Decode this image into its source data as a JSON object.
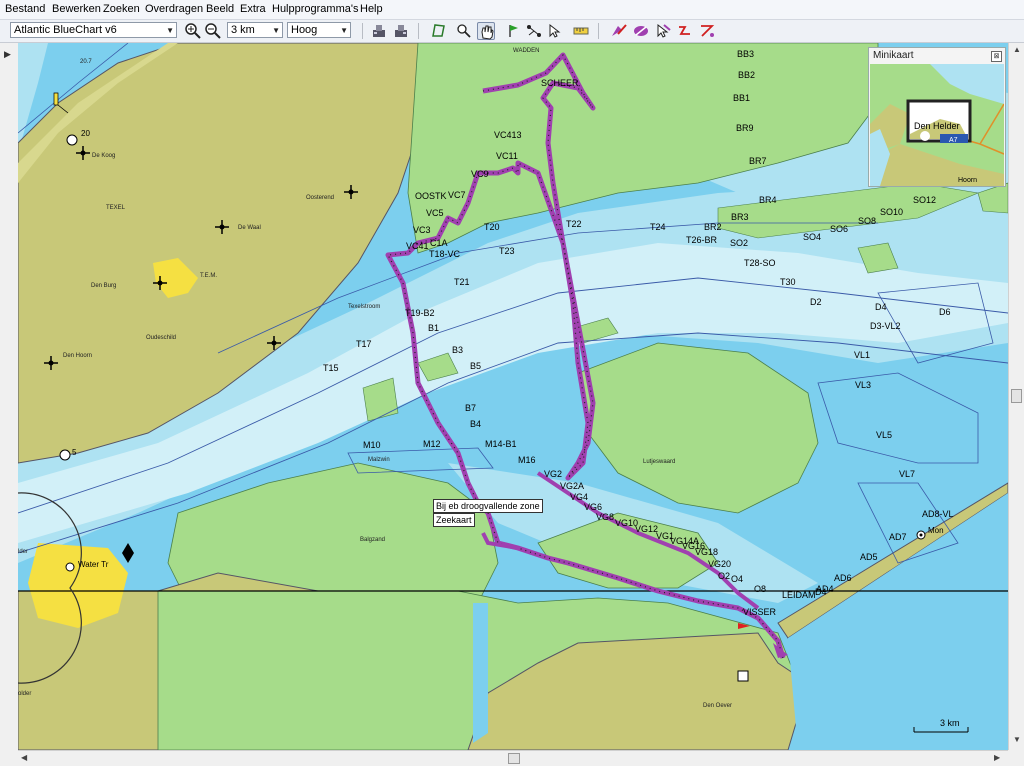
{
  "menu": [
    "Bestand",
    "Bewerken",
    "Zoeken",
    "Overdragen",
    "Beeld",
    "Extra",
    "Hulpprogramma's",
    "Help"
  ],
  "toolbar": {
    "map_product": "Atlantic BlueChart v6",
    "zoom_level": "3 km",
    "detail_level": "Hoog"
  },
  "minimap": {
    "title": "Minikaart",
    "close": "⊠",
    "place": "Den Helder",
    "road": "A7",
    "place2": "Hoorn"
  },
  "map": {
    "places": {
      "wadden": "WADDEN",
      "texel": "TEXEL",
      "de_koog": "De Koog",
      "oosterend": "Oosterend",
      "de_waal": "De Waal",
      "tem": "T.E.M.",
      "den_burg": "Den Burg",
      "oudeschild": "Oudeschild",
      "den_hoorn": "Den Hoorn",
      "texelstroom": "Texelstroom",
      "malzwin": "Malzwin",
      "balgzand": "Balgzand",
      "lutjeswaard": "Lutjeswaard",
      "water_tr": "Water Tr",
      "den_oever": "Den Oever",
      "mon": "Mon",
      "num_20_7": "20.7",
      "num_20": "20",
      "num_5": "5",
      "lder": "lder",
      "olderl": "older"
    },
    "buoys": {
      "bb3": "BB3",
      "bb2": "BB2",
      "bb1": "BB1",
      "br9": "BR9",
      "br7": "BR7",
      "br4": "BR4",
      "br3": "BR3",
      "br2": "BR2",
      "t26br": "T26-BR",
      "so2": "SO2",
      "so4": "SO4",
      "so6": "SO6",
      "so8": "SO8",
      "so10": "SO10",
      "so12": "SO12",
      "t28so": "T28-SO",
      "t30": "T30",
      "t24": "T24",
      "t22": "T22",
      "t20": "T20",
      "t23": "T23",
      "t21": "T21",
      "t18vc": "T18-VC",
      "t19b2": "T19-B2",
      "t17": "T17",
      "t15": "T15",
      "b1": "B1",
      "b3": "B3",
      "b5": "B5",
      "b7": "B7",
      "b4": "B4",
      "m10": "M10",
      "m12": "M12",
      "m14b1": "M14-B1",
      "m16": "M16",
      "vc413": "VC413",
      "vc11": "VC11",
      "vc9": "VC9",
      "vc7": "VC7",
      "vc5": "VC5",
      "vc3": "VC3",
      "vc1a": "C1A",
      "vc41": "VC41",
      "oostk": "OOSTK",
      "scheer": "SCHEER",
      "d2": "D2",
      "d4": "D4",
      "d6": "D6",
      "d3vl2": "D3-VL2",
      "vl1": "VL1",
      "vl3": "VL3",
      "vl5": "VL5",
      "vl7": "VL7",
      "vg2": "VG2",
      "vg2a": "VG2A",
      "vg4": "VG4",
      "vg6": "VG6",
      "vg8": "VG8",
      "vg10": "VG10",
      "vg12": "VG12",
      "vg14": "VG1",
      "vg14a": "VG14A",
      "vg16": "VG16",
      "vg18": "VG18",
      "vg20": "VG20",
      "o2": "O2",
      "o4": "O4",
      "o8": "O8",
      "leidam": "LEIDAM",
      "d4b": "D4",
      "visser": "VISSER",
      "ad4": "AD4",
      "ad5": "AD5",
      "ad6": "AD6",
      "ad7": "AD7",
      "ad8vl": "AD8-VL"
    },
    "tooltip_line1": "Bij eb droogvallende zone",
    "tooltip_line2": "Zeekaart",
    "scale": "3 km"
  },
  "colors": {
    "land": "#c8c878",
    "sea": "#7ccfee",
    "shallow": "#aee2f2",
    "fairway": "#d2f0f8",
    "flat": "#a6dc8a",
    "route": "#a040b0",
    "buoy": "#000000"
  }
}
